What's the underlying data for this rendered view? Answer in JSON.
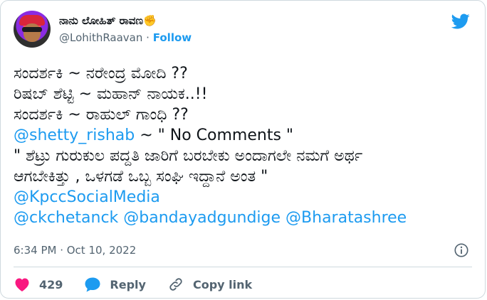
{
  "author": {
    "display_name": "ನಾನು ಲೋಹಿತ್ ರಾವಣ",
    "emoji": "✊",
    "handle": "@LohithRaavan",
    "separator": "·",
    "follow_label": "Follow"
  },
  "tweet": {
    "line1": "ಸಂದರ್ಶಕಿ ~ ನರೇಂದ್ರ ಮೋದಿ ??",
    "line2": "ರಿಷಬ್ ಶೆಟ್ಟಿ ~ ಮಹಾನ್ ನಾಯಕ..!!",
    "line3": "ಸಂದರ್ಶಕಿ ~ ರಾಹುಲ್ ಗಾಂಧಿ ??",
    "line4_mention": "@shetty_rishab",
    "line4_rest": " ~ \" No Comments \"",
    "line5": "\" ಶೆಟ್ರು ಗುರುಕುಲ ಪದ್ದತಿ ಜಾರಿಗೆ ಬರಬೇಕು ಅಂದಾಗಲೇ ನಮಗೆ ಅರ್ಥ",
    "line6": "ಆಗಬೇಕಿತ್ತು , ಒಳಗಡೆ ಒಬ್ಬ ಸಂಘಿ ಇದ್ದಾನೆ ಅಂತ \"",
    "mention_kpcc": "@KpccSocialMedia",
    "mention_ckchetanck": "@ckchetanck",
    "mention_bandayadgundige": "@bandayadgundige",
    "mention_bharatashree": "@Bharatashree"
  },
  "meta": {
    "timestamp": "6:34 PM · Oct 10, 2022"
  },
  "actions": {
    "like_count": "429",
    "reply_label": "Reply",
    "copy_link_label": "Copy link"
  },
  "colors": {
    "accent": "#1d9bf0",
    "like": "#f91880",
    "muted": "#536471",
    "text": "#0f1419"
  },
  "icons": [
    "twitter-bird-icon",
    "info-icon",
    "heart-icon",
    "reply-bubble-icon",
    "link-icon"
  ]
}
